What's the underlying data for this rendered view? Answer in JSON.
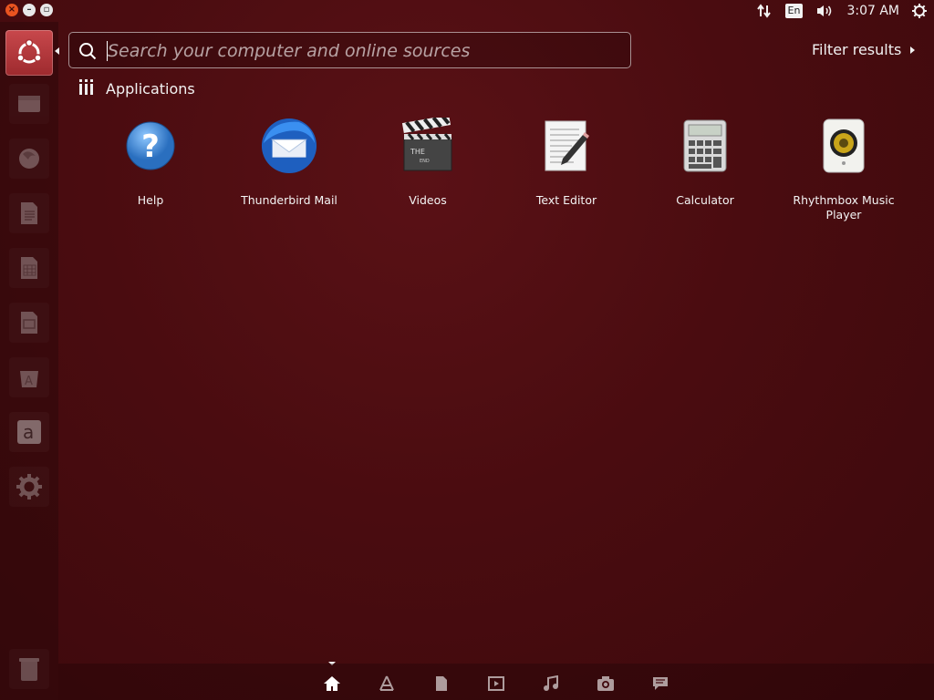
{
  "window_controls": {
    "close_icon": "close-icon",
    "minimize_icon": "minimize-icon",
    "maximize_icon": "maximize-icon"
  },
  "panel": {
    "network_icon": "network-updown-icon",
    "keyboard_layout": "En",
    "sound_icon": "volume-icon",
    "clock": "3:07 AM",
    "session_icon": "gear-power-icon"
  },
  "launcher": {
    "items": [
      {
        "name": "ubuntu-dash-icon",
        "active": true
      },
      {
        "name": "files-icon"
      },
      {
        "name": "firefox-icon"
      },
      {
        "name": "libreoffice-writer-icon"
      },
      {
        "name": "libreoffice-calc-icon"
      },
      {
        "name": "libreoffice-impress-icon"
      },
      {
        "name": "software-center-icon"
      },
      {
        "name": "amazon-icon"
      },
      {
        "name": "system-settings-icon"
      },
      {
        "name": "trash-icon"
      }
    ]
  },
  "search": {
    "value": "",
    "placeholder": "Search your computer and online sources"
  },
  "filter": {
    "label": "Filter results"
  },
  "category": {
    "label": "Applications",
    "icon": "applications-category-icon"
  },
  "apps": [
    {
      "label": "Help",
      "icon": "help-icon"
    },
    {
      "label": "Thunderbird Mail",
      "icon": "thunderbird-icon"
    },
    {
      "label": "Videos",
      "icon": "videos-clapperboard-icon"
    },
    {
      "label": "Text Editor",
      "icon": "text-editor-icon"
    },
    {
      "label": "Calculator",
      "icon": "calculator-icon"
    },
    {
      "label": "Rhythmbox Music Player",
      "icon": "rhythmbox-speaker-icon"
    }
  ],
  "lenses": [
    {
      "name": "home-lens-icon",
      "active": true
    },
    {
      "name": "applications-lens-icon"
    },
    {
      "name": "files-lens-icon"
    },
    {
      "name": "video-lens-icon"
    },
    {
      "name": "music-lens-icon"
    },
    {
      "name": "photo-lens-icon"
    },
    {
      "name": "social-lens-icon"
    }
  ],
  "colors": {
    "background": "#4a0c10",
    "accent": "#e95420"
  }
}
